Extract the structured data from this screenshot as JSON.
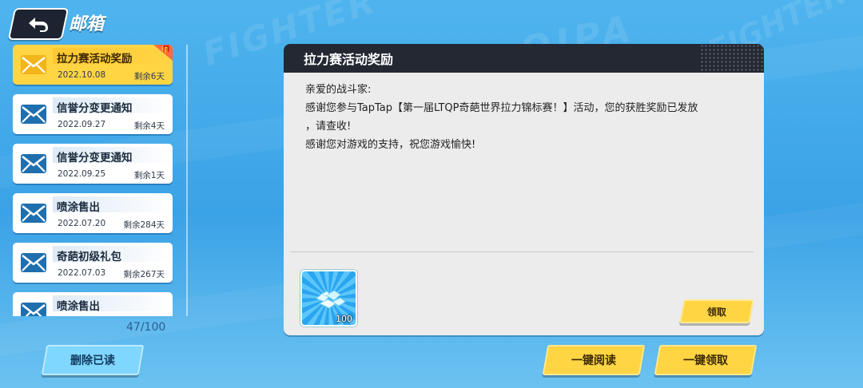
{
  "header": {
    "title": "邮箱"
  },
  "mails": [
    {
      "subject": "拉力赛活动奖励",
      "date": "2022.10.08",
      "remaining": "剩余6天",
      "selected": true,
      "has_gift": true
    },
    {
      "subject": "信誉分变更通知",
      "date": "2022.09.27",
      "remaining": "剩余4天",
      "selected": false
    },
    {
      "subject": "信誉分变更通知",
      "date": "2022.09.25",
      "remaining": "剩余1天",
      "selected": false
    },
    {
      "subject": "喷涂售出",
      "date": "2022.07.20",
      "remaining": "剩余284天",
      "selected": false
    },
    {
      "subject": "奇葩初级礼包",
      "date": "2022.07.03",
      "remaining": "剩余267天",
      "selected": false
    },
    {
      "subject": "喷涂售出",
      "date": "",
      "remaining": "",
      "selected": false
    }
  ],
  "mail_count": "47/100",
  "buttons": {
    "delete_read": "删除已读",
    "read_all": "一键阅读",
    "claim_all": "一键领取",
    "claim": "领取"
  },
  "detail": {
    "title": "拉力赛活动奖励",
    "lines": [
      "亲爱的战斗家:",
      "感谢您参与TapTap【第一届LTQP奇葩世界拉力锦标赛！】活动，您的获胜奖励已发放",
      "，请查收!",
      "感谢您对游戏的支持，祝您游戏愉快!"
    ],
    "reward": {
      "icon": "diamond-pile-icon",
      "quantity": "100"
    }
  },
  "colors": {
    "accent_yellow": "#ffd544",
    "panel_header": "#232833",
    "mail_icon_blue": "#1f6fae",
    "mail_icon_yellow": "#f2b51a"
  }
}
